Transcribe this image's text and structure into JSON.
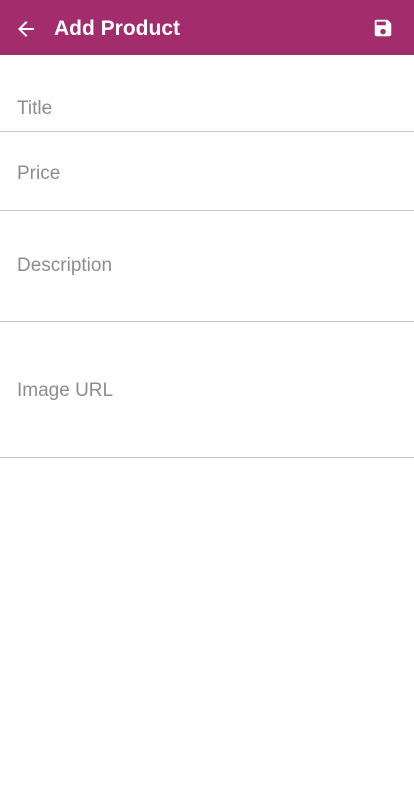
{
  "app_bar": {
    "title": "Add Product",
    "back_icon": "arrow-left-icon",
    "save_icon": "save-icon",
    "background": "#a32d6c"
  },
  "form": {
    "fields": [
      {
        "label": "Title"
      },
      {
        "label": "Price"
      },
      {
        "label": "Description"
      },
      {
        "label": "Image URL"
      }
    ]
  }
}
